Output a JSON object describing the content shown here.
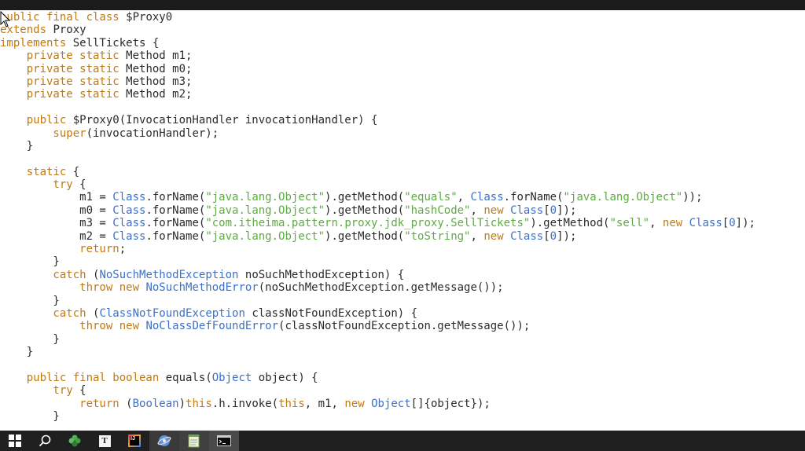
{
  "editor": {
    "lines": [
      [
        {
          "t": "public final class ",
          "c": "kw"
        },
        {
          "t": "$Proxy0",
          "c": ""
        }
      ],
      [
        {
          "t": "extends ",
          "c": "kw"
        },
        {
          "t": "Proxy",
          "c": ""
        }
      ],
      [
        {
          "t": "implements ",
          "c": "kw"
        },
        {
          "t": "SellTickets {",
          "c": ""
        }
      ],
      [
        {
          "t": "    private static ",
          "c": "kw"
        },
        {
          "t": "Method m1;",
          "c": ""
        }
      ],
      [
        {
          "t": "    private static ",
          "c": "kw"
        },
        {
          "t": "Method m0;",
          "c": ""
        }
      ],
      [
        {
          "t": "    private static ",
          "c": "kw"
        },
        {
          "t": "Method m3;",
          "c": ""
        }
      ],
      [
        {
          "t": "    private static ",
          "c": "kw"
        },
        {
          "t": "Method m2;",
          "c": ""
        }
      ],
      [
        {
          "t": "",
          "c": ""
        }
      ],
      [
        {
          "t": "    public ",
          "c": "kw"
        },
        {
          "t": "$Proxy0(InvocationHandler invocationHandler) {",
          "c": ""
        }
      ],
      [
        {
          "t": "        super",
          "c": "kw"
        },
        {
          "t": "(invocationHandler);",
          "c": ""
        }
      ],
      [
        {
          "t": "    }",
          "c": ""
        }
      ],
      [
        {
          "t": "",
          "c": ""
        }
      ],
      [
        {
          "t": "    static ",
          "c": "kw"
        },
        {
          "t": "{",
          "c": ""
        }
      ],
      [
        {
          "t": "        try ",
          "c": "kw"
        },
        {
          "t": "{",
          "c": ""
        }
      ],
      [
        {
          "t": "            m1 = ",
          "c": ""
        },
        {
          "t": "Class",
          "c": "type"
        },
        {
          "t": ".forName(",
          "c": ""
        },
        {
          "t": "\"java.lang.Object\"",
          "c": "str"
        },
        {
          "t": ").getMethod(",
          "c": ""
        },
        {
          "t": "\"equals\"",
          "c": "str"
        },
        {
          "t": ", ",
          "c": ""
        },
        {
          "t": "Class",
          "c": "type"
        },
        {
          "t": ".forName(",
          "c": ""
        },
        {
          "t": "\"java.lang.Object\"",
          "c": "str"
        },
        {
          "t": "));",
          "c": ""
        }
      ],
      [
        {
          "t": "            m0 = ",
          "c": ""
        },
        {
          "t": "Class",
          "c": "type"
        },
        {
          "t": ".forName(",
          "c": ""
        },
        {
          "t": "\"java.lang.Object\"",
          "c": "str"
        },
        {
          "t": ").getMethod(",
          "c": ""
        },
        {
          "t": "\"hashCode\"",
          "c": "str"
        },
        {
          "t": ", ",
          "c": ""
        },
        {
          "t": "new ",
          "c": "kw"
        },
        {
          "t": "Class",
          "c": "type"
        },
        {
          "t": "[",
          "c": ""
        },
        {
          "t": "0",
          "c": "num"
        },
        {
          "t": "]);",
          "c": ""
        }
      ],
      [
        {
          "t": "            m3 = ",
          "c": ""
        },
        {
          "t": "Class",
          "c": "type"
        },
        {
          "t": ".forName(",
          "c": ""
        },
        {
          "t": "\"com.itheima.pattern.proxy.jdk_proxy.SellTickets\"",
          "c": "str"
        },
        {
          "t": ").getMethod(",
          "c": ""
        },
        {
          "t": "\"sell\"",
          "c": "str"
        },
        {
          "t": ", ",
          "c": ""
        },
        {
          "t": "new ",
          "c": "kw"
        },
        {
          "t": "Class",
          "c": "type"
        },
        {
          "t": "[",
          "c": ""
        },
        {
          "t": "0",
          "c": "num"
        },
        {
          "t": "]);",
          "c": ""
        }
      ],
      [
        {
          "t": "            m2 = ",
          "c": ""
        },
        {
          "t": "Class",
          "c": "type"
        },
        {
          "t": ".forName(",
          "c": ""
        },
        {
          "t": "\"java.lang.Object\"",
          "c": "str"
        },
        {
          "t": ").getMethod(",
          "c": ""
        },
        {
          "t": "\"toString\"",
          "c": "str"
        },
        {
          "t": ", ",
          "c": ""
        },
        {
          "t": "new ",
          "c": "kw"
        },
        {
          "t": "Class",
          "c": "type"
        },
        {
          "t": "[",
          "c": ""
        },
        {
          "t": "0",
          "c": "num"
        },
        {
          "t": "]);",
          "c": ""
        }
      ],
      [
        {
          "t": "            return",
          "c": "kw"
        },
        {
          "t": ";",
          "c": ""
        }
      ],
      [
        {
          "t": "        }",
          "c": ""
        }
      ],
      [
        {
          "t": "        catch ",
          "c": "kw"
        },
        {
          "t": "(",
          "c": ""
        },
        {
          "t": "NoSuchMethodException",
          "c": "type"
        },
        {
          "t": " noSuchMethodException) {",
          "c": ""
        }
      ],
      [
        {
          "t": "            throw new ",
          "c": "kw"
        },
        {
          "t": "NoSuchMethodError",
          "c": "type"
        },
        {
          "t": "(noSuchMethodException.getMessage());",
          "c": ""
        }
      ],
      [
        {
          "t": "        }",
          "c": ""
        }
      ],
      [
        {
          "t": "        catch ",
          "c": "kw"
        },
        {
          "t": "(",
          "c": ""
        },
        {
          "t": "ClassNotFoundException",
          "c": "type"
        },
        {
          "t": " classNotFoundException) {",
          "c": ""
        }
      ],
      [
        {
          "t": "            throw new ",
          "c": "kw"
        },
        {
          "t": "NoClassDefFoundError",
          "c": "type"
        },
        {
          "t": "(classNotFoundException.getMessage());",
          "c": ""
        }
      ],
      [
        {
          "t": "        }",
          "c": ""
        }
      ],
      [
        {
          "t": "    }",
          "c": ""
        }
      ],
      [
        {
          "t": "",
          "c": ""
        }
      ],
      [
        {
          "t": "    public final boolean ",
          "c": "kw"
        },
        {
          "t": "equals(",
          "c": ""
        },
        {
          "t": "Object",
          "c": "type"
        },
        {
          "t": " object) {",
          "c": ""
        }
      ],
      [
        {
          "t": "        try ",
          "c": "kw"
        },
        {
          "t": "{",
          "c": ""
        }
      ],
      [
        {
          "t": "            return ",
          "c": "kw"
        },
        {
          "t": "(",
          "c": ""
        },
        {
          "t": "Boolean",
          "c": "type"
        },
        {
          "t": ")",
          "c": ""
        },
        {
          "t": "this",
          "c": "kw"
        },
        {
          "t": ".h.invoke(",
          "c": ""
        },
        {
          "t": "this",
          "c": "kw"
        },
        {
          "t": ", m1, ",
          "c": ""
        },
        {
          "t": "new ",
          "c": "kw"
        },
        {
          "t": "Object",
          "c": "type"
        },
        {
          "t": "[]{object});",
          "c": ""
        }
      ],
      [
        {
          "t": "        }",
          "c": ""
        }
      ]
    ]
  },
  "taskbar": {
    "items": [
      {
        "name": "start-button",
        "icon": "windows-logo-icon"
      },
      {
        "name": "search-button",
        "icon": "search-icon"
      },
      {
        "name": "clover-app",
        "icon": "clover-icon"
      },
      {
        "name": "typora-app",
        "icon": "typora-icon",
        "label": "T"
      },
      {
        "name": "intellij-app",
        "icon": "intellij-icon",
        "label": "IJ"
      },
      {
        "name": "browser-app",
        "icon": "browser-icon"
      },
      {
        "name": "notepad-app",
        "icon": "notepad-icon"
      },
      {
        "name": "terminal-app",
        "icon": "terminal-icon"
      }
    ]
  }
}
